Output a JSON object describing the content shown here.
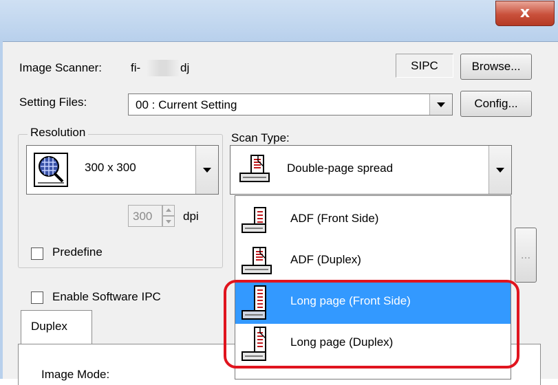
{
  "window": {
    "close_glyph": "x"
  },
  "scanner": {
    "label": "Image Scanner:",
    "model_prefix": "fi-",
    "model_suffix": "dj",
    "sipc_label": "SIPC",
    "browse_label": "Browse..."
  },
  "settings": {
    "label": "Setting Files:",
    "value": "00 : Current Setting",
    "config_label": "Config..."
  },
  "resolution": {
    "group_label": "Resolution",
    "value": "300 x 300",
    "dpi_value": "300",
    "dpi_unit": "dpi",
    "predefine_label": "Predefine"
  },
  "scan_type": {
    "label": "Scan Type:",
    "value": "Double-page spread",
    "options": [
      {
        "label": "ADF (Front Side)",
        "icon": "adf-front-icon"
      },
      {
        "label": "ADF (Duplex)",
        "icon": "adf-duplex-icon"
      },
      {
        "label": "Long page (Front Side)",
        "icon": "long-page-front-icon"
      },
      {
        "label": "Long page (Duplex)",
        "icon": "long-page-duplex-icon"
      }
    ],
    "selected_index": 2
  },
  "software_ipc": {
    "label": "Enable Software IPC"
  },
  "tabs": [
    {
      "label": "Duplex"
    }
  ],
  "image_mode": {
    "label": "Image Mode:"
  },
  "side_button": {
    "label": "..."
  },
  "colors": {
    "highlight": "#3399ff",
    "annotation": "#e0141e"
  }
}
